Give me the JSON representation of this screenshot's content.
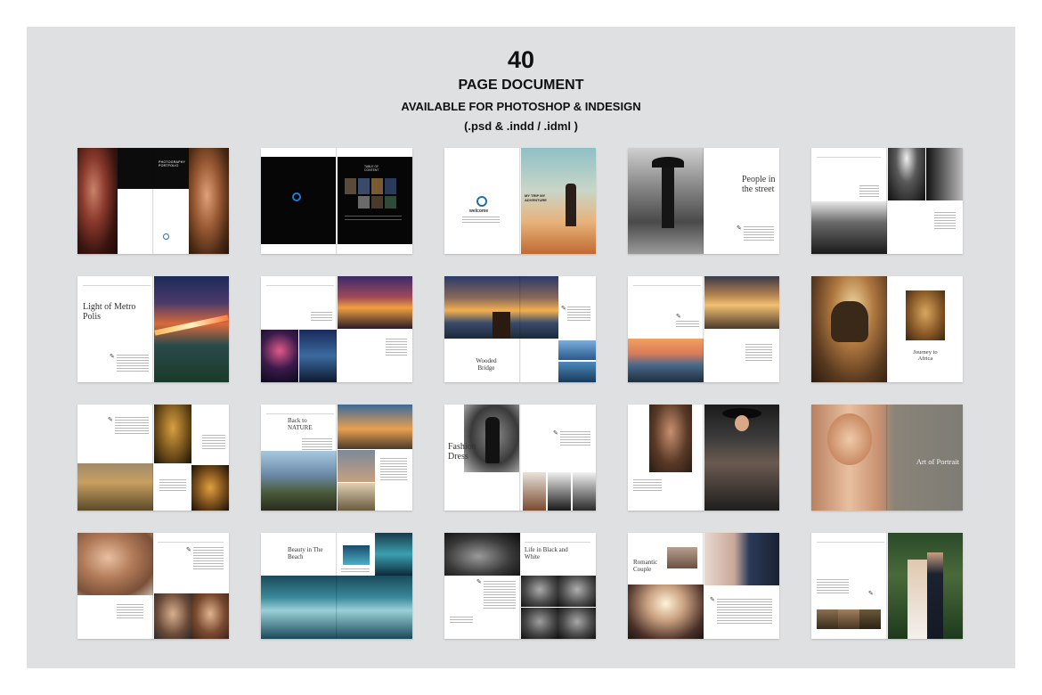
{
  "header": {
    "count": "40",
    "line1": "PAGE DOCUMENT",
    "line2": "AVAILABLE FOR PHOTOSHOP & INDESIGN",
    "line3": "(.psd & .indd / .idml )"
  },
  "spreads": [
    {
      "titles": [
        "PHOTOGRAPHY PORTFOLIO"
      ]
    },
    {
      "titles": [
        "TABLE OF CONTENT"
      ]
    },
    {
      "titles": [
        "welcome",
        "MY TRIP MY ADVENTURE"
      ]
    },
    {
      "titles": [
        "People in the street"
      ]
    },
    {
      "titles": []
    },
    {
      "titles": [
        "Light of Metro Polis"
      ]
    },
    {
      "titles": []
    },
    {
      "titles": [
        "Wooded Bridge"
      ]
    },
    {
      "titles": []
    },
    {
      "titles": [
        "Journey to Africa"
      ]
    },
    {
      "titles": []
    },
    {
      "titles": [
        "Back to NATURE"
      ]
    },
    {
      "titles": [
        "Fashion Dress"
      ]
    },
    {
      "titles": []
    },
    {
      "titles": [
        "Art of Portrait"
      ]
    },
    {
      "titles": []
    },
    {
      "titles": [
        "Beauty in The Beach"
      ]
    },
    {
      "titles": [
        "Life in Black and White"
      ]
    },
    {
      "titles": [
        "Romantic Couple"
      ]
    },
    {
      "titles": []
    }
  ],
  "colors": {
    "panel": "#dfe0e2",
    "page": "#ffffff",
    "heading": "#111111"
  }
}
